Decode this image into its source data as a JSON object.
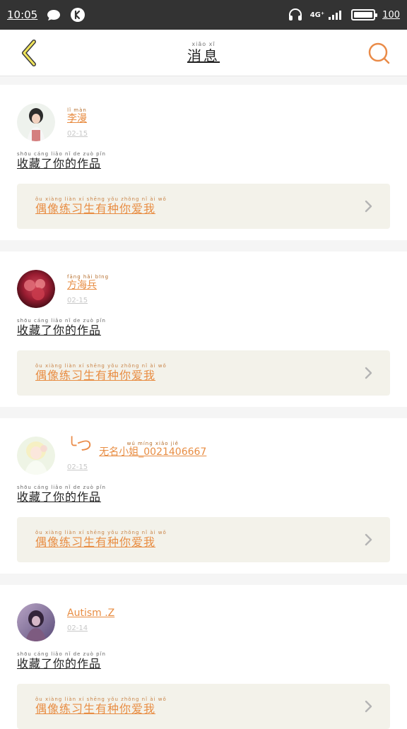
{
  "status_bar": {
    "time": "10:05",
    "network_label": "4G⁺",
    "battery_text": "100"
  },
  "header": {
    "title_pinyin": "xiāo xī",
    "title": "消息"
  },
  "messages": [
    {
      "name_pinyin": "lǐ màn",
      "name": "李漫",
      "time": "02-15",
      "message_pinyin": "shōu cáng liǎo nǐ de zuò pǐn",
      "message": "收藏了你的作品",
      "work_pinyin": "ǒu xiàng liàn xí shēng yǒu zhǒng nǐ ài wǒ",
      "work": "偶像练习生有种你爱我"
    },
    {
      "name_pinyin": "fāng hǎi bīng",
      "name": "方海兵",
      "time": "02-15",
      "message_pinyin": "shōu cáng liǎo nǐ de zuò pǐn",
      "message": "收藏了你的作品",
      "work_pinyin": "ǒu xiàng liàn xí shēng yǒu zhǒng nǐ ài wǒ",
      "work": "偶像练习生有种你爱我"
    },
    {
      "prefix": "╰つ",
      "name_pinyin": "wú míng xiǎo jiě",
      "name": "无名小姐_0021406667",
      "time": "02-15",
      "message_pinyin": "shōu cáng liǎo nǐ de zuò pǐn",
      "message": "收藏了你的作品",
      "work_pinyin": "ǒu xiàng liàn xí shēng yǒu zhǒng nǐ ài wǒ",
      "work": "偶像练习生有种你爱我"
    },
    {
      "name": "Autism .Z",
      "time": "02-14",
      "message_pinyin": "shōu cáng liǎo nǐ de zuò pǐn",
      "message": "收藏了你的作品",
      "work_pinyin": "ǒu xiàng liàn xí shēng yǒu zhǒng nǐ ài wǒ",
      "work": "偶像练习生有种你爱我"
    }
  ],
  "icons": {
    "back": "back-arrow-icon",
    "search": "search-icon",
    "chat": "chat-bubble-icon",
    "app": "k-app-icon",
    "headphones": "headphones-icon",
    "signal": "signal-icon",
    "battery": "battery-icon",
    "chevron": "chevron-right-icon"
  },
  "colors": {
    "accent": "#e88d43",
    "status_bar": "#333333",
    "back_icon": "#f0e45a"
  }
}
